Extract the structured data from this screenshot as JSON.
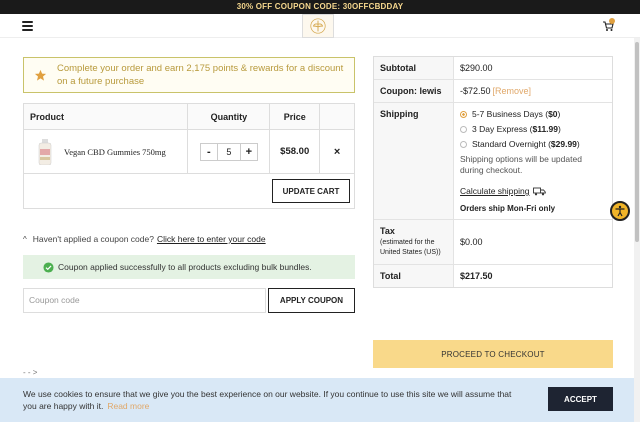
{
  "promo": {
    "text": "30% OFF COUPON CODE: 30OFFCBDDAY"
  },
  "rewards": {
    "text": "Complete your order and earn 2,175 points & rewards for a discount on a future purchase"
  },
  "cart": {
    "headers": {
      "product": "Product",
      "quantity": "Quantity",
      "price": "Price"
    },
    "items": [
      {
        "name": "Vegan CBD Gummies 750mg",
        "quantity": "5",
        "price": "$58.00",
        "remove": "×"
      }
    ],
    "stepper": {
      "minus": "-",
      "plus": "+"
    },
    "update_label": "UPDATE CART"
  },
  "coupon": {
    "prompt": "Haven't applied a coupon code?",
    "link": "Click here to enter your code",
    "success": "Coupon applied successfully to all products excluding bulk bundles.",
    "placeholder": "Coupon code",
    "apply_label": "APPLY COUPON"
  },
  "stray_text": "- - >",
  "totals": {
    "subtotal_label": "Subtotal",
    "subtotal_value": "$290.00",
    "coupon_label": "Coupon: lewis",
    "coupon_value": "-$72.50",
    "coupon_remove": "[Remove]",
    "shipping_label": "Shipping",
    "shipping_options": [
      {
        "name": "5-7 Business Days (",
        "price": "$0",
        "suffix": ")",
        "selected": true
      },
      {
        "name": "3 Day Express (",
        "price": "$11.99",
        "suffix": ")",
        "selected": false
      },
      {
        "name": "Standard Overnight (",
        "price": "$29.99",
        "suffix": ")",
        "selected": false
      }
    ],
    "shipping_note": "Shipping options will be updated during checkout.",
    "calculate_shipping": "Calculate shipping",
    "ship_days": "Orders ship Mon-Fri only",
    "tax_label": "Tax",
    "tax_sub": "(estimated for the United States (US))",
    "tax_value": "$0.00",
    "total_label": "Total",
    "total_value": "$217.50"
  },
  "checkout_label": "PROCEED TO CHECKOUT",
  "cookie": {
    "text": "We use cookies to ensure that we give you the best experience on our website. If you continue to use this site we will assume that you are happy with it.",
    "read_more": "Read more",
    "accept": "ACCEPT"
  },
  "colors": {
    "accent": "#e0a040",
    "checkout": "#f9d98a",
    "success_bg": "#e4f2e3",
    "cookie_bg": "#d9e8f6"
  },
  "icons": [
    "menu-icon",
    "logo-icon",
    "cart-icon",
    "star-icon",
    "check-circle-icon",
    "truck-icon",
    "accessibility-icon"
  ]
}
